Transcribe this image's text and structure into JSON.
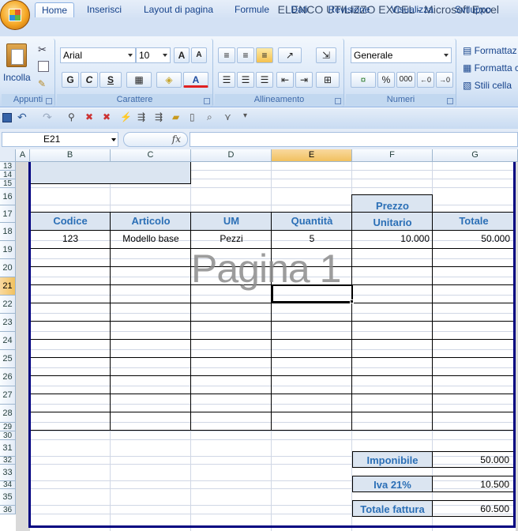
{
  "window": {
    "title": "ELENCO UTILIZZO EXCEL - Microsoft Excel"
  },
  "tabs": [
    "Home",
    "Inserisci",
    "Layout di pagina",
    "Formule",
    "Dati",
    "Revisione",
    "Visualizza",
    "Sviluppo"
  ],
  "ribbon": {
    "appunti": {
      "label": "Appunti",
      "paste_label": "Incolla"
    },
    "carattere": {
      "label": "Carattere",
      "font": "Arial",
      "size": "10",
      "bold": "G",
      "italic": "C",
      "underline": "S",
      "grow": "A",
      "shrink": "A",
      "color": "A"
    },
    "allineamento": {
      "label": "Allineamento"
    },
    "numeri": {
      "label": "Numeri",
      "format": "Generale",
      "percent": "%",
      "thousands": "000"
    },
    "stili": {
      "format_cond": "Formattaz",
      "format_table": "Formatta c",
      "cell_styles": "Stili cella"
    }
  },
  "formula_bar": {
    "name_box": "E21",
    "fx": "fx",
    "value": ""
  },
  "columns": [
    "A",
    "B",
    "C",
    "D",
    "E",
    "F",
    "G"
  ],
  "rows": [
    "13",
    "14",
    "15",
    "16",
    "17",
    "18",
    "19",
    "20",
    "21",
    "22",
    "23",
    "24",
    "25",
    "26",
    "27",
    "28",
    "29",
    "30",
    "31",
    "32",
    "33",
    "34",
    "35",
    "36"
  ],
  "sheet": {
    "headers": {
      "codice": "Codice",
      "articolo": "Articolo",
      "um": "UM",
      "quantita": "Quantità",
      "prezzo1": "Prezzo",
      "prezzo2": "Unitario",
      "totale": "Totale"
    },
    "row18": {
      "codice": "123",
      "articolo": "Modello base",
      "um": "Pezzi",
      "quantita": "5",
      "prezzo": "10.000",
      "totale": "50.000"
    },
    "page_watermark": "Pagina 1",
    "summary": [
      {
        "label": "Imponibile",
        "value": "50.000"
      },
      {
        "label": "Iva 21%",
        "value": "10.500"
      },
      {
        "label": "Totale fattura",
        "value": "60.500"
      }
    ]
  },
  "colors": {
    "accent": "#15428b",
    "header_text": "#2b6fb6",
    "header_fill": "#dbe5f1",
    "selected_header": "#f1c15f",
    "page_border": "#000080"
  }
}
